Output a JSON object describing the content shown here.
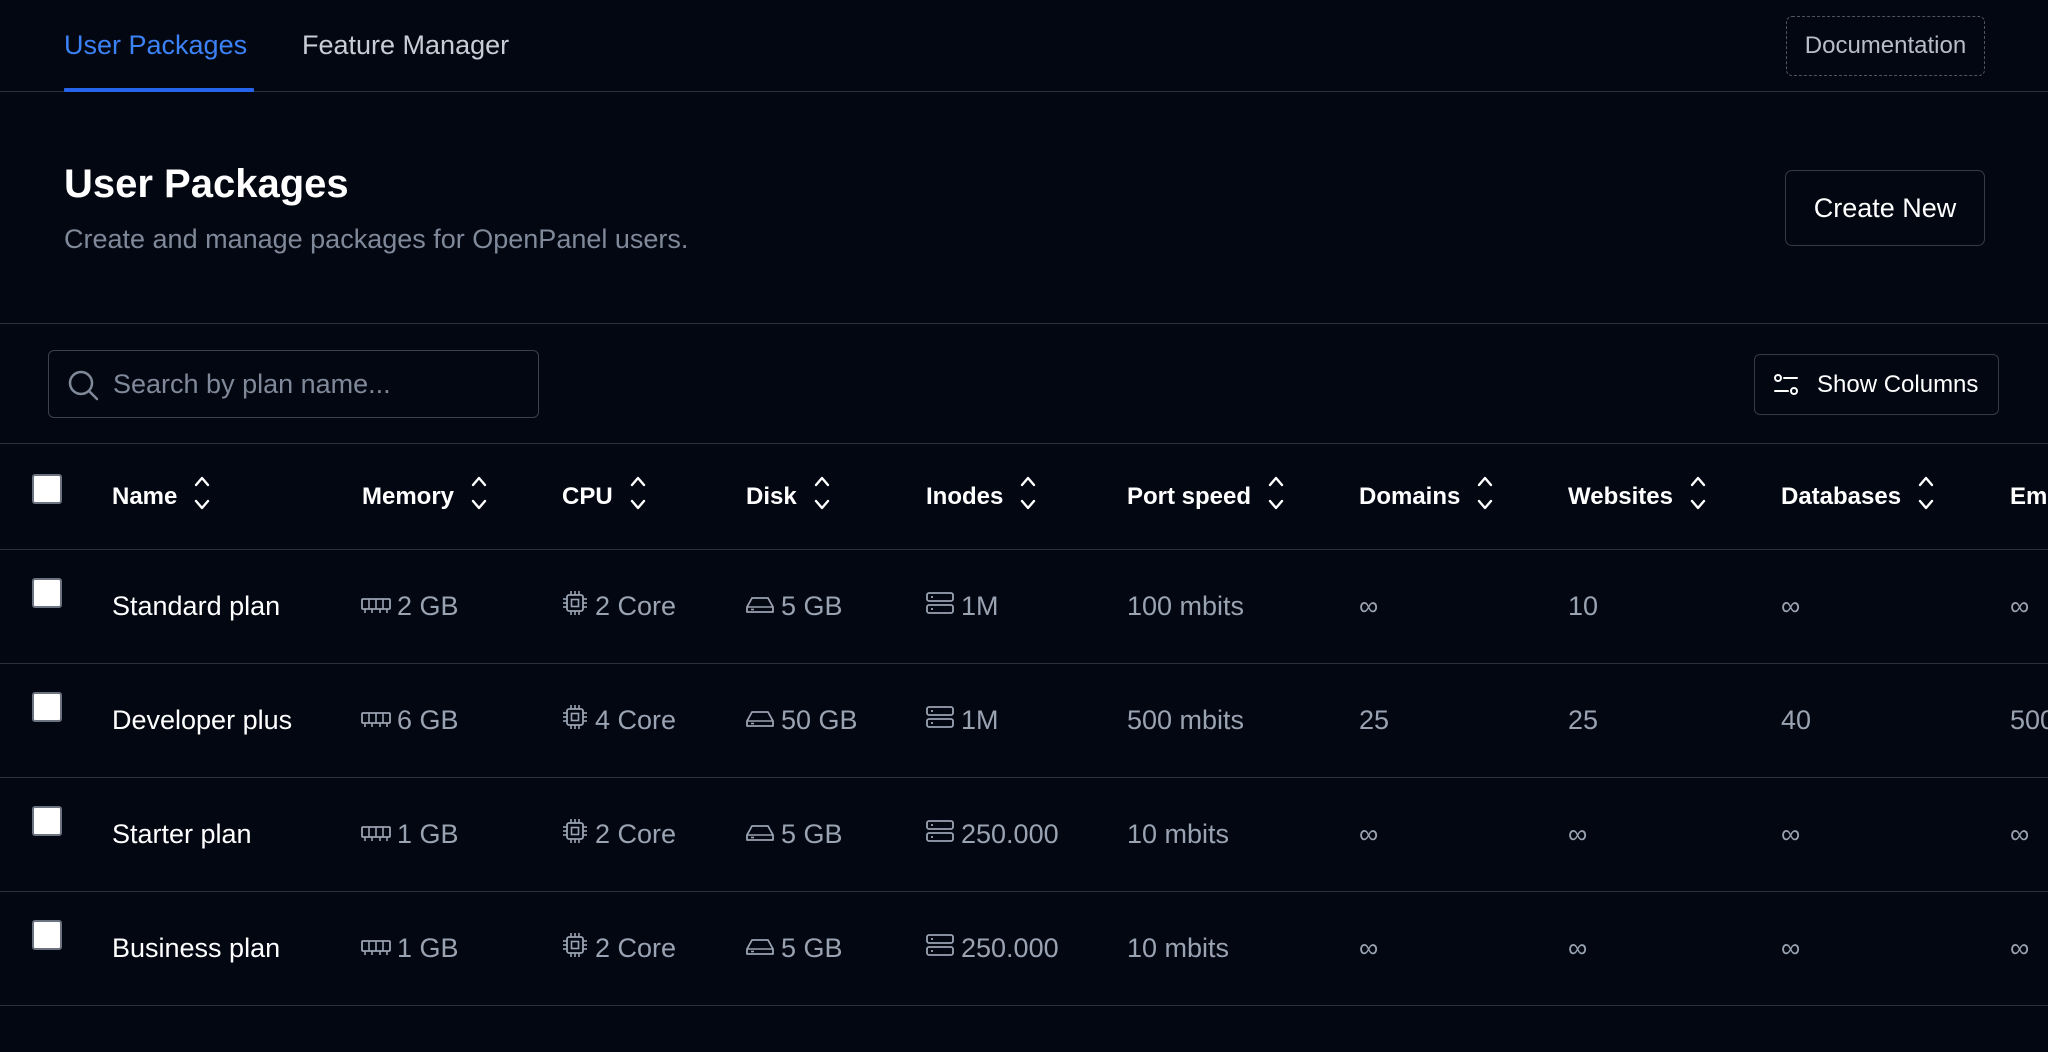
{
  "tabs": [
    {
      "label": "User Packages",
      "active": true
    },
    {
      "label": "Feature Manager",
      "active": false
    }
  ],
  "documentation_label": "Documentation",
  "header": {
    "title": "User Packages",
    "subtitle": "Create and manage packages for OpenPanel users.",
    "create_label": "Create New"
  },
  "search": {
    "placeholder": "Search by plan name..."
  },
  "show_columns_label": "Show Columns",
  "colors": {
    "accent": "#3b82f6",
    "background": "#030712",
    "border": "#2a313c"
  },
  "table": {
    "columns": [
      "Name",
      "Memory",
      "CPU",
      "Disk",
      "Inodes",
      "Port speed",
      "Domains",
      "Websites",
      "Databases",
      "Em"
    ],
    "rows": [
      {
        "name": "Standard plan",
        "memory": "2 GB",
        "cpu": "2 Core",
        "disk": "5 GB",
        "inodes": "1M",
        "port_speed": "100 mbits",
        "domains": "∞",
        "websites": "10",
        "databases": "∞",
        "email": "∞"
      },
      {
        "name": "Developer plus",
        "memory": "6 GB",
        "cpu": "4 Core",
        "disk": "50 GB",
        "inodes": "1M",
        "port_speed": "500 mbits",
        "domains": "25",
        "websites": "25",
        "databases": "40",
        "email": "500"
      },
      {
        "name": "Starter plan",
        "memory": "1 GB",
        "cpu": "2 Core",
        "disk": "5 GB",
        "inodes": "250.000",
        "port_speed": "10 mbits",
        "domains": "∞",
        "websites": "∞",
        "databases": "∞",
        "email": "∞"
      },
      {
        "name": "Business plan",
        "memory": "1 GB",
        "cpu": "2 Core",
        "disk": "5 GB",
        "inodes": "250.000",
        "port_speed": "10 mbits",
        "domains": "∞",
        "websites": "∞",
        "databases": "∞",
        "email": "∞"
      }
    ]
  }
}
